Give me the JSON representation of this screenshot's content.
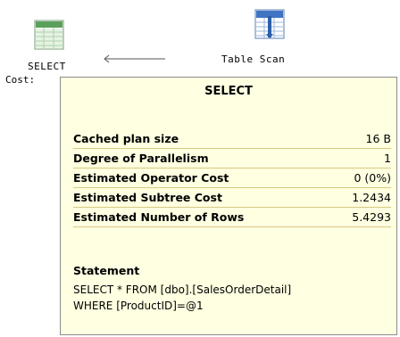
{
  "plan": {
    "select_node": {
      "label": "SELECT",
      "cost_label": "Cost:",
      "icon": "select-result-icon"
    },
    "scan_node": {
      "label": "Table Scan",
      "icon": "table-scan-icon"
    }
  },
  "tooltip": {
    "title": "SELECT",
    "rows": [
      {
        "key": "Cached plan size",
        "value": "16 B"
      },
      {
        "key": "Degree of Parallelism",
        "value": "1"
      },
      {
        "key": "Estimated Operator Cost",
        "value": "0 (0%)"
      },
      {
        "key": "Estimated Subtree Cost",
        "value": "1.2434"
      },
      {
        "key": "Estimated Number of Rows",
        "value": "5.4293"
      }
    ],
    "statement_title": "Statement",
    "statement": "SELECT * FROM [dbo].[SalesOrderDetail]\nWHERE [ProductID]=@1"
  }
}
